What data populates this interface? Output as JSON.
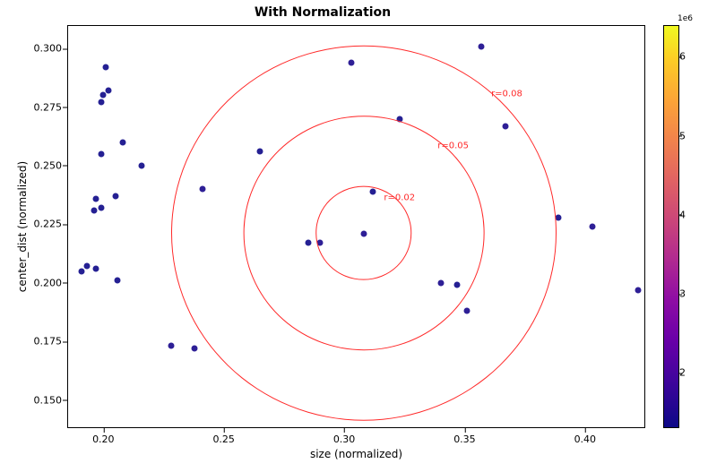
{
  "chart_data": {
    "type": "scatter",
    "title": "With Normalization",
    "xlabel": "size (normalized)",
    "ylabel": "center_dist (normalized)",
    "xlim": [
      0.185,
      0.425
    ],
    "ylim": [
      0.138,
      0.31
    ],
    "x_ticks": [
      0.2,
      0.25,
      0.3,
      0.35,
      0.4
    ],
    "y_ticks": [
      0.15,
      0.175,
      0.2,
      0.225,
      0.25,
      0.275,
      0.3
    ],
    "colorbar": {
      "label_exp": "1e6",
      "vmin": 1.3,
      "vmax": 6.4,
      "ticks": [
        2,
        3,
        4,
        5,
        6
      ]
    },
    "center": {
      "x": 0.3081,
      "y": 0.2212
    },
    "rings": [
      {
        "r": 0.02,
        "label": "r=0.02"
      },
      {
        "r": 0.05,
        "label": "r=0.05"
      },
      {
        "r": 0.08,
        "label": "r=0.08"
      }
    ],
    "series": [
      {
        "name": "points",
        "points": [
          {
            "x": 0.191,
            "y": 0.205,
            "c": 1.3
          },
          {
            "x": 0.193,
            "y": 0.207,
            "c": 1.3
          },
          {
            "x": 0.197,
            "y": 0.206,
            "c": 1.3
          },
          {
            "x": 0.196,
            "y": 0.231,
            "c": 1.3
          },
          {
            "x": 0.197,
            "y": 0.236,
            "c": 1.3
          },
          {
            "x": 0.199,
            "y": 0.232,
            "c": 1.3
          },
          {
            "x": 0.199,
            "y": 0.255,
            "c": 1.3
          },
          {
            "x": 0.199,
            "y": 0.277,
            "c": 1.3
          },
          {
            "x": 0.2,
            "y": 0.28,
            "c": 1.3
          },
          {
            "x": 0.202,
            "y": 0.282,
            "c": 1.3
          },
          {
            "x": 0.201,
            "y": 0.292,
            "c": 1.3
          },
          {
            "x": 0.205,
            "y": 0.237,
            "c": 1.3
          },
          {
            "x": 0.206,
            "y": 0.201,
            "c": 1.3
          },
          {
            "x": 0.208,
            "y": 0.26,
            "c": 1.3
          },
          {
            "x": 0.216,
            "y": 0.25,
            "c": 1.3
          },
          {
            "x": 0.228,
            "y": 0.173,
            "c": 1.4
          },
          {
            "x": 0.238,
            "y": 0.172,
            "c": 1.4
          },
          {
            "x": 0.241,
            "y": 0.24,
            "c": 1.4
          },
          {
            "x": 0.265,
            "y": 0.256,
            "c": 1.3
          },
          {
            "x": 0.285,
            "y": 0.217,
            "c": 1.3
          },
          {
            "x": 0.29,
            "y": 0.217,
            "c": 1.4
          },
          {
            "x": 0.303,
            "y": 0.294,
            "c": 1.4
          },
          {
            "x": 0.308,
            "y": 0.221,
            "c": 1.4
          },
          {
            "x": 0.312,
            "y": 0.239,
            "c": 1.3
          },
          {
            "x": 0.323,
            "y": 0.27,
            "c": 1.3
          },
          {
            "x": 0.34,
            "y": 0.2,
            "c": 1.4
          },
          {
            "x": 0.347,
            "y": 0.199,
            "c": 1.3
          },
          {
            "x": 0.351,
            "y": 0.188,
            "c": 1.4
          },
          {
            "x": 0.357,
            "y": 0.301,
            "c": 1.4
          },
          {
            "x": 0.367,
            "y": 0.267,
            "c": 1.4
          },
          {
            "x": 0.389,
            "y": 0.228,
            "c": 1.3
          },
          {
            "x": 0.403,
            "y": 0.224,
            "c": 1.4
          },
          {
            "x": 0.422,
            "y": 0.197,
            "c": 1.4
          }
        ]
      }
    ]
  }
}
